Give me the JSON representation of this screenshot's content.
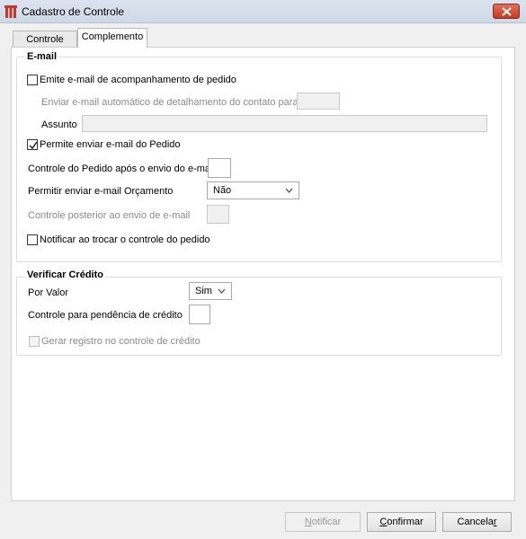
{
  "window": {
    "title": "Cadastro de Controle"
  },
  "tabs": [
    {
      "label": "Controle"
    },
    {
      "label": "Complemento"
    }
  ],
  "email": {
    "legend": "E-mail",
    "emite_email": {
      "label": "Emite e-mail de acompanhamento de pedido",
      "checked": false
    },
    "enviar_auto": {
      "label": "Enviar e-mail automático de detalhamento do contato para",
      "value": ""
    },
    "assunto": {
      "label": "Assunto",
      "value": ""
    },
    "permite_email": {
      "label": "Permite enviar e-mail do Pedido",
      "checked": true
    },
    "controle_apos": {
      "label": "Controle do Pedido após o envio do e-mail",
      "value": ""
    },
    "permitir_orcamento": {
      "label": "Permitir enviar e-mail Orçamento",
      "value": "Não"
    },
    "controle_posterior": {
      "label": "Controle posterior ao envio de e-mail",
      "value": ""
    },
    "notificar": {
      "label": "Notificar ao trocar o controle do pedido",
      "checked": false
    }
  },
  "credito": {
    "legend": "Verificar Crédito",
    "por_valor": {
      "label": "Por Valor",
      "value": "Sim"
    },
    "controle_pendencia": {
      "label": "Controle para pendência de crédito",
      "value": ""
    },
    "gerar_registro": {
      "label": "Gerar registro no controle de crédito",
      "checked": false
    }
  },
  "buttons": {
    "notificar": {
      "prefix": "",
      "key": "N",
      "rest": "otificar"
    },
    "confirmar": {
      "prefix": "",
      "key": "C",
      "rest": "onfirmar"
    },
    "cancelar": {
      "prefix": "Cancela",
      "key": "r",
      "rest": ""
    }
  }
}
